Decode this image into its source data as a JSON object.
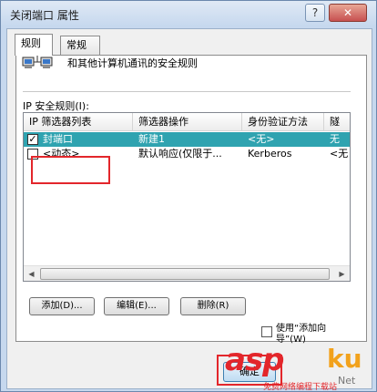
{
  "window": {
    "title": "关闭端口 属性",
    "help_label": "?",
    "close_label": "✕"
  },
  "tabs": [
    {
      "label": "规则"
    },
    {
      "label": "常规"
    }
  ],
  "panel": {
    "heading": "和其他计算机通讯的安全规则",
    "list_label": "IP 安全规则(I):",
    "columns": [
      "IP 筛选器列表",
      "筛选器操作",
      "身份验证方法",
      "隧"
    ],
    "rows": [
      {
        "checked": true,
        "name": "封端口",
        "action": "新建1",
        "auth": "<无>",
        "tunnel": "无"
      },
      {
        "checked": false,
        "name": "<动态>",
        "action": "默认响应(仅限于...",
        "auth": "Kerberos",
        "tunnel": "<无"
      }
    ]
  },
  "buttons": {
    "add": "添加(D)...",
    "edit": "编辑(E)...",
    "remove": "删除(R)",
    "use_wizard": "使用“添加向导”(W)",
    "ok": "确定"
  },
  "watermark": {
    "asp": "asp",
    "ku": "ku",
    "net": "Net",
    "sub": "免费网络编程下载站"
  },
  "colors": {
    "accent_highlight": "#e3262b",
    "selected_row": "#2fa3b0",
    "brand_orange": "#f2a21c"
  },
  "icons": {
    "network": "network-computers-icon",
    "close": "close-icon",
    "help": "help-icon"
  }
}
